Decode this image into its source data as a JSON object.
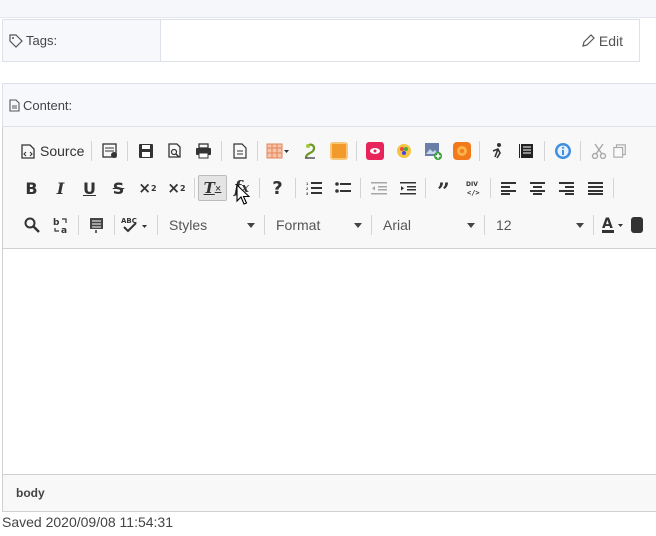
{
  "tags": {
    "label": "Tags:",
    "edit_label": "Edit"
  },
  "content": {
    "label": "Content:"
  },
  "editor": {
    "source_label": "Source",
    "combos": {
      "styles": "Styles",
      "format": "Format",
      "font": "Arial",
      "size": "12"
    },
    "icons_row1": [
      "source-icon",
      "templates-icon",
      "save-icon",
      "preview-icon",
      "print-icon",
      "new-page-icon",
      "table-icon",
      "anchor-icon",
      "image-frame-icon",
      "flash-icon",
      "color-picker-icon",
      "image-add-icon",
      "smiley-icon",
      "accessibility-icon",
      "page-break-icon",
      "info-icon",
      "cut-icon",
      "copy-icon"
    ],
    "icons_row2": [
      "bold",
      "italic",
      "underline",
      "strikethrough",
      "subscript",
      "superscript",
      "remove-format",
      "formula",
      "help",
      "numbered-list",
      "bulleted-list",
      "outdent",
      "indent",
      "blockquote",
      "div",
      "align-left",
      "align-center",
      "align-right",
      "justify"
    ],
    "statusbar_path": "body"
  },
  "saved_text": "Saved 2020/09/08 11:54:31",
  "colors": {
    "accent": "#1a73e8",
    "border": "#d1d1d1",
    "toolbar_bg": "#f8f8f8"
  }
}
